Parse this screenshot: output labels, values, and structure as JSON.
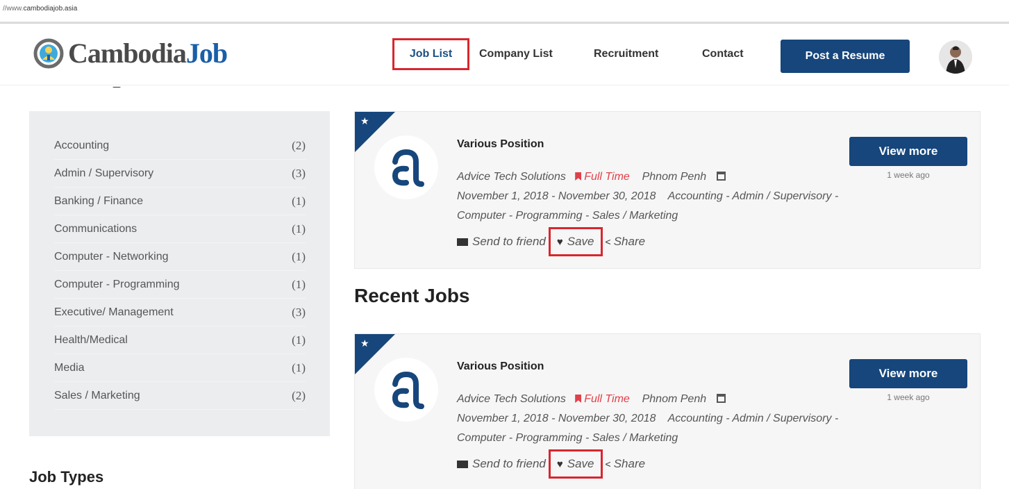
{
  "browser": {
    "url_prefix": "//www.",
    "url_domain": "cambodiajob.asia"
  },
  "header": {
    "logo": {
      "text_part1": "Cambodia",
      "text_part2": "Job"
    },
    "nav": [
      "Job List",
      "Company List",
      "Recruitment",
      "Contact"
    ],
    "post_button": "Post a Resume"
  },
  "sidebar": {
    "categories": [
      {
        "label": "Accounting",
        "count": "(2)"
      },
      {
        "label": "Admin / Supervisory",
        "count": "(3)"
      },
      {
        "label": "Banking / Finance",
        "count": "(1)"
      },
      {
        "label": "Communications",
        "count": "(1)"
      },
      {
        "label": "Computer - Networking",
        "count": "(1)"
      },
      {
        "label": "Computer - Programming",
        "count": "(1)"
      },
      {
        "label": "Executive/ Management",
        "count": "(3)"
      },
      {
        "label": "Health/Medical",
        "count": "(1)"
      },
      {
        "label": "Media",
        "count": "(1)"
      },
      {
        "label": "Sales / Marketing",
        "count": "(2)"
      }
    ],
    "job_types_title": "Job Types"
  },
  "recent_title": "Recent Jobs",
  "jobs": [
    {
      "title": "Various Position",
      "company": "Advice Tech Solutions",
      "type": "Full Time",
      "location": "Phnom Penh",
      "dates": "November 1, 2018 - November 30, 2018",
      "categories": "Accounting - Admin / Supervisory - Computer - Programming - Sales / Marketing",
      "send": "Send to friend",
      "save": "Save",
      "share": "Share",
      "view_more": "View more",
      "posted": "1 week ago"
    },
    {
      "title": "Various Position",
      "company": "Advice Tech Solutions",
      "type": "Full Time",
      "location": "Phnom Penh",
      "dates": "November 1, 2018 - November 30, 2018",
      "categories": "Accounting - Admin / Supervisory - Computer - Programming - Sales / Marketing",
      "send": "Send to friend",
      "save": "Save",
      "share": "Share",
      "view_more": "View more",
      "posted": "1 week ago"
    }
  ],
  "colors": {
    "brand_blue": "#16467b",
    "highlight_red": "#d8262e",
    "sidebar_bg": "#ebedef"
  }
}
